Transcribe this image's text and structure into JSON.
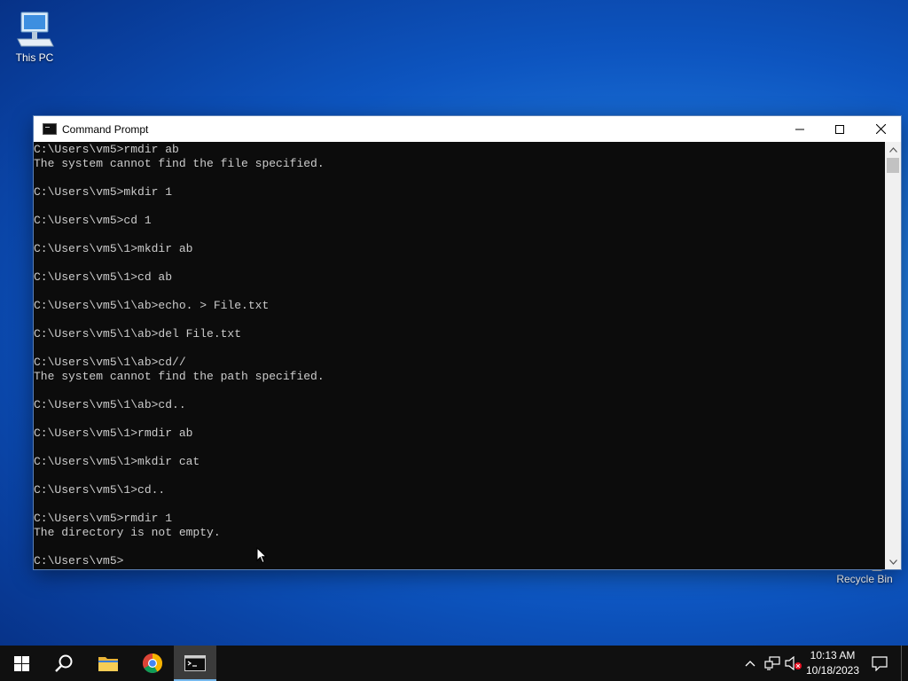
{
  "desktop": {
    "this_pc_label": "This PC",
    "recycle_bin_label": "Recycle Bin"
  },
  "window": {
    "title": "Command Prompt",
    "lines": [
      "C:\\Users\\vm5>rmdir ab",
      "The system cannot find the file specified.",
      "",
      "C:\\Users\\vm5>mkdir 1",
      "",
      "C:\\Users\\vm5>cd 1",
      "",
      "C:\\Users\\vm5\\1>mkdir ab",
      "",
      "C:\\Users\\vm5\\1>cd ab",
      "",
      "C:\\Users\\vm5\\1\\ab>echo. > File.txt",
      "",
      "C:\\Users\\vm5\\1\\ab>del File.txt",
      "",
      "C:\\Users\\vm5\\1\\ab>cd//",
      "The system cannot find the path specified.",
      "",
      "C:\\Users\\vm5\\1\\ab>cd..",
      "",
      "C:\\Users\\vm5\\1>rmdir ab",
      "",
      "C:\\Users\\vm5\\1>mkdir cat",
      "",
      "C:\\Users\\vm5\\1>cd..",
      "",
      "C:\\Users\\vm5>rmdir 1",
      "The directory is not empty.",
      "",
      "C:\\Users\\vm5>"
    ]
  },
  "taskbar": {
    "time": "10:13 AM",
    "date": "10/18/2023",
    "icons": [
      "start-icon",
      "search-icon",
      "file-explorer-icon",
      "chrome-icon",
      "command-prompt-icon"
    ]
  },
  "colors": {
    "console_bg": "#0c0c0c",
    "console_fg": "#cccccc",
    "taskbar_bg": "#101010",
    "active_indicator": "#76b9ed"
  }
}
